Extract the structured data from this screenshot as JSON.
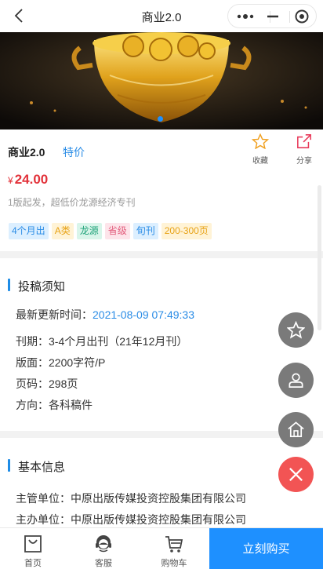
{
  "nav": {
    "title": "商业2.0"
  },
  "product": {
    "title": "商业2.0",
    "tag_link": "特价",
    "fav_label": "收藏",
    "share_label": "分享",
    "price_symbol": "¥",
    "price": "24.00",
    "desc": "1版起发，超低价龙源经济专刊",
    "tags": [
      {
        "text": "4个月出",
        "color": "#2a8ce6",
        "bg": "#dcefff"
      },
      {
        "text": "A类",
        "color": "#e8a317",
        "bg": "#fff3d6"
      },
      {
        "text": "龙源",
        "color": "#21a37a",
        "bg": "#d9f5ea"
      },
      {
        "text": "省级",
        "color": "#e25d7c",
        "bg": "#fde4ea"
      },
      {
        "text": "旬刊",
        "color": "#2a8ce6",
        "bg": "#dcefff"
      },
      {
        "text": "200-300页",
        "color": "#e8a317",
        "bg": "#fff3d6"
      }
    ]
  },
  "notice": {
    "heading": "投稿须知",
    "update_label": "最新更新时间：",
    "update_value": "2021-08-09 07:49:33",
    "items": [
      "刊期：3-4个月出刊（21年12月刊）",
      "版面：2200字符/P",
      "页码：298页",
      "方向：各科稿件"
    ]
  },
  "basic": {
    "heading": "基本信息",
    "items": [
      "主管单位：中原出版传媒投资控股集团有限公司",
      "主办单位：中原出版传媒投资控股集团有限公司"
    ]
  },
  "bottom": {
    "tabs": [
      {
        "label": "首页",
        "icon": "bag-icon"
      },
      {
        "label": "客服",
        "icon": "headset-icon"
      },
      {
        "label": "购物车",
        "icon": "cart-icon"
      }
    ],
    "buy_label": "立刻购买"
  },
  "colors": {
    "accent": "#1e90ff",
    "price": "#e2323a",
    "fab": "#7a7a7a",
    "fab_close": "#f25454"
  }
}
